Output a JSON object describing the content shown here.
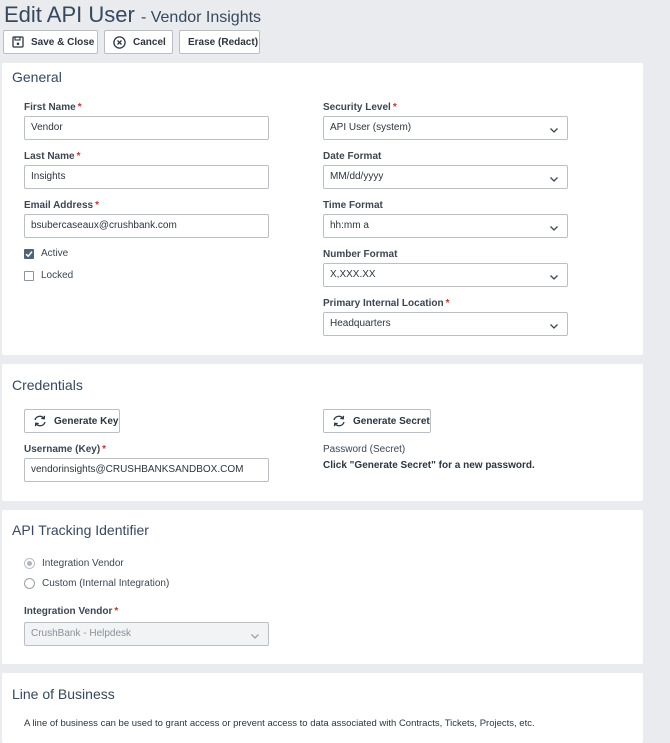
{
  "header": {
    "title": "Edit API User",
    "subtitle": "- Vendor Insights"
  },
  "toolbar": {
    "save_label": "Save & Close",
    "cancel_label": "Cancel",
    "erase_label": "Erase (Redact)"
  },
  "general": {
    "title": "General",
    "first_name": {
      "label": "First Name",
      "value": "Vendor"
    },
    "last_name": {
      "label": "Last Name",
      "value": "Insights"
    },
    "email": {
      "label": "Email Address",
      "value": "bsubercaseaux@crushbank.com"
    },
    "active": {
      "label": "Active",
      "checked": true
    },
    "locked": {
      "label": "Locked",
      "checked": false
    },
    "security_level": {
      "label": "Security Level",
      "value": "API User (system)"
    },
    "date_format": {
      "label": "Date Format",
      "value": "MM/dd/yyyy"
    },
    "time_format": {
      "label": "Time Format",
      "value": "hh:mm a"
    },
    "number_format": {
      "label": "Number Format",
      "value": "X,XXX.XX"
    },
    "primary_location": {
      "label": "Primary Internal Location",
      "value": "Headquarters"
    }
  },
  "credentials": {
    "title": "Credentials",
    "generate_key_label": "Generate Key",
    "generate_secret_label": "Generate Secret",
    "username_label": "Username (Key)",
    "username_value": "vendorinsights@CRUSHBANKSANDBOX.COM",
    "password_label": "Password (Secret)",
    "password_hint": "Click \"Generate Secret\" for a new password."
  },
  "tracking": {
    "title": "API Tracking Identifier",
    "option_vendor": "Integration Vendor",
    "option_custom": "Custom (Internal Integration)",
    "selected": "Integration Vendor",
    "vendor_label": "Integration Vendor",
    "vendor_value": "CrushBank - Helpdesk"
  },
  "line_of_business": {
    "title": "Line of Business",
    "description": "A line of business can be used to grant access or prevent access to data associated with Contracts, Tickets, Projects, etc."
  },
  "colors": {
    "accent": "#37485e",
    "required": "#c0392b",
    "checkbox": "#4d6479"
  }
}
